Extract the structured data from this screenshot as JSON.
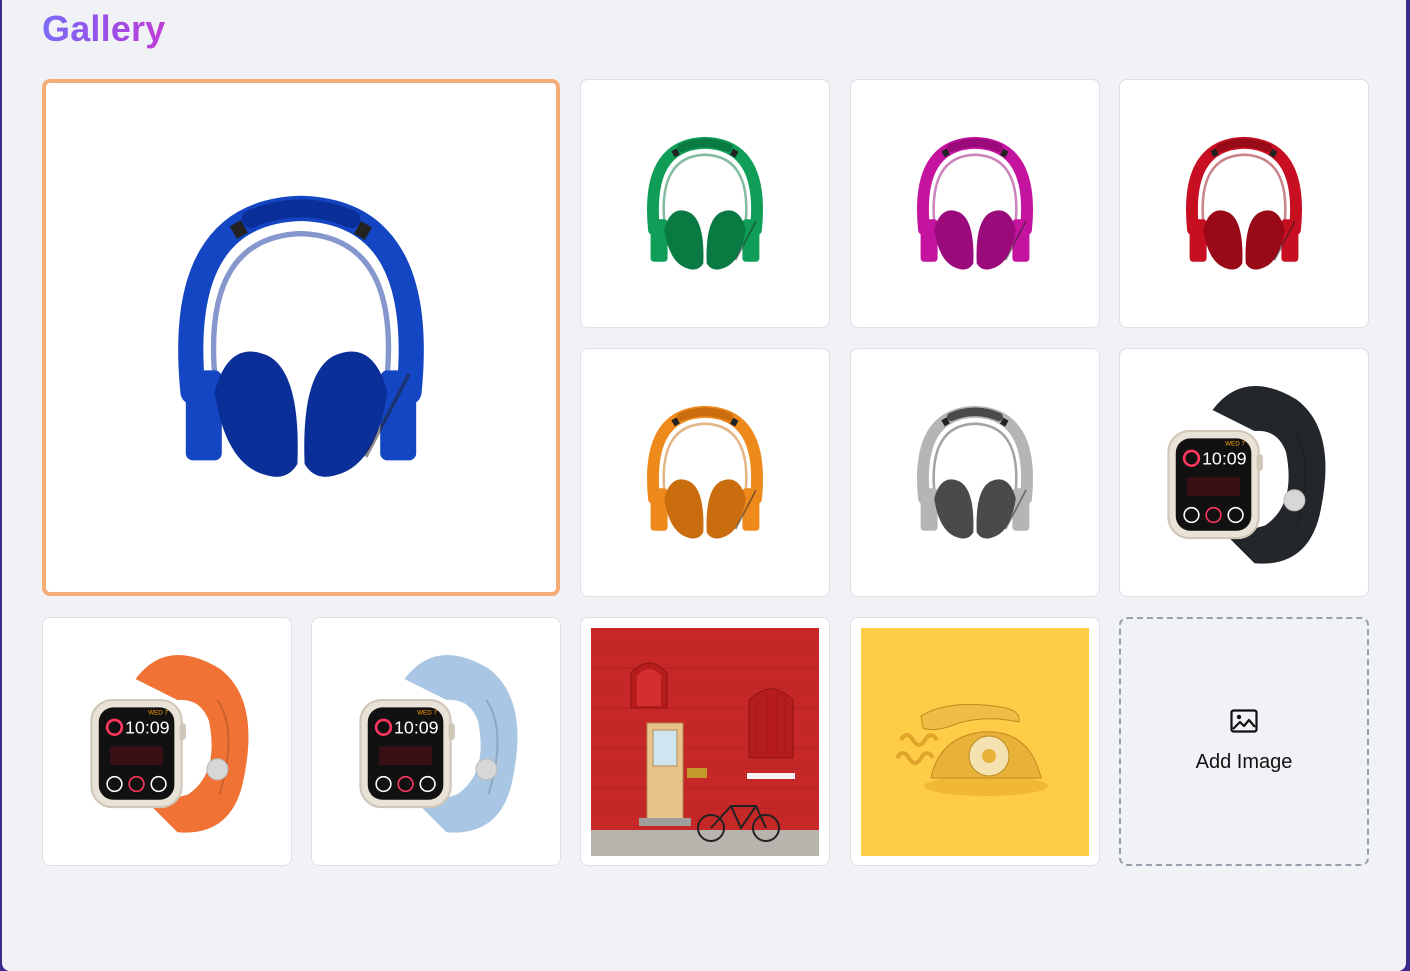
{
  "header": {
    "title": "Gallery"
  },
  "gallery": {
    "featured_index": 0,
    "items": [
      {
        "icon": "headphones-icon",
        "color": "#1446c4",
        "dark": "#0b2f99"
      },
      {
        "icon": "headphones-icon",
        "color": "#0f9d58",
        "dark": "#0a7a43"
      },
      {
        "icon": "headphones-icon",
        "color": "#c4139e",
        "dark": "#9a0a7b"
      },
      {
        "icon": "headphones-icon",
        "color": "#c80f22",
        "dark": "#990a18"
      },
      {
        "icon": "headphones-icon",
        "color": "#ee8a1c",
        "dark": "#c96d0f"
      },
      {
        "icon": "headphones-icon",
        "color": "#b5b5b5",
        "dark": "#4a4a4a"
      },
      {
        "icon": "watch-icon",
        "color": "#23262b",
        "time": "10:09",
        "date": "WED 7"
      },
      {
        "icon": "watch-icon",
        "color": "#f07235",
        "time": "10:09",
        "date": "WED 7"
      },
      {
        "icon": "watch-icon",
        "color": "#a9c7e4",
        "time": "10:09",
        "date": "WED 7"
      },
      {
        "icon": "brick-wall-photo",
        "color": "#c62828"
      },
      {
        "icon": "telephone-photo",
        "color": "#ffcc47"
      }
    ],
    "add_button": {
      "label": "Add Image",
      "icon": "image-icon"
    }
  }
}
